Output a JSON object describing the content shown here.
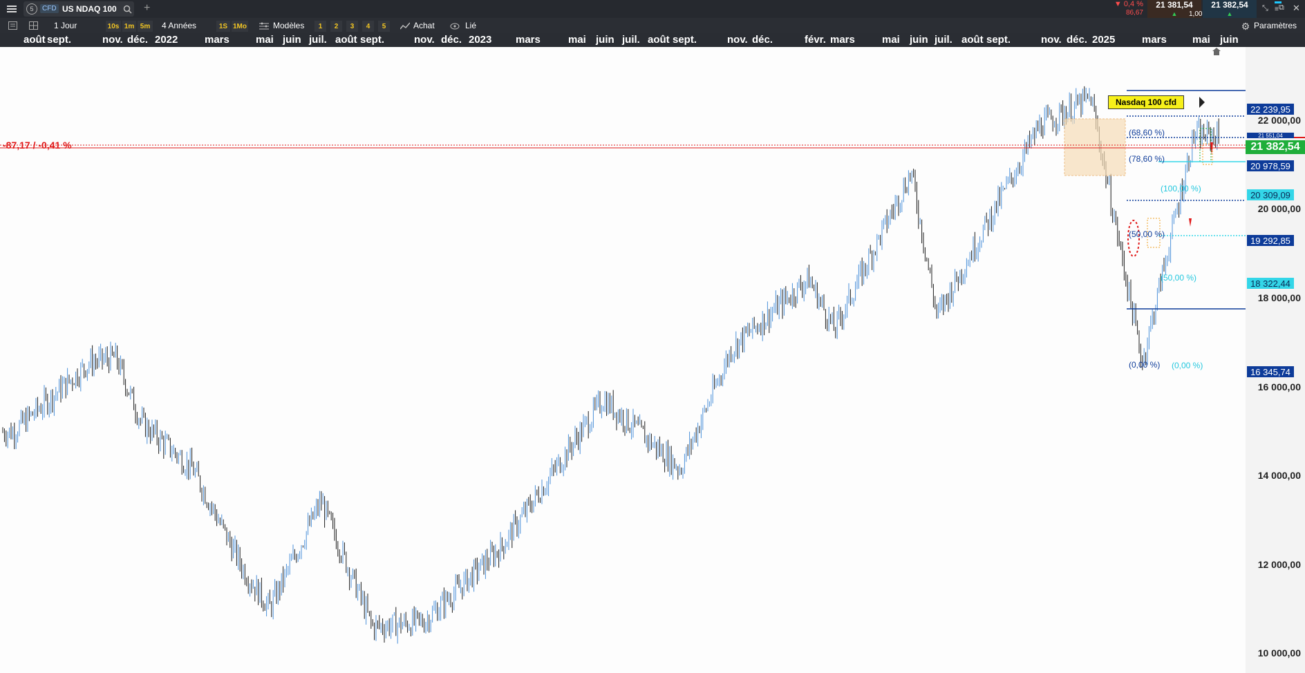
{
  "instrument": {
    "badge": "CFD",
    "name": "US NDAQ 100",
    "label": "Nasdaq 100  cfd"
  },
  "topbar": {
    "change_pct": "▼ 0,4 %",
    "change_pts": "86,67",
    "bid": "21 381,54",
    "ask": "21 382,54",
    "spread": "1,00",
    "plus": "+"
  },
  "toolbar": {
    "period": "1 Jour",
    "intervals": [
      "10s",
      "1m",
      "5m"
    ],
    "range": "4 Années",
    "periods": [
      "1S",
      "1Mo"
    ],
    "models": "Modèles",
    "layouts": [
      "1",
      "2",
      "3",
      "4",
      "5"
    ],
    "buy": "Achat",
    "linked": "Lié",
    "settings": "Paramètres"
  },
  "months": [
    "août",
    "sept.",
    "nov.",
    "déc.",
    "2022",
    "mars",
    "mai",
    "juin",
    "juil.",
    "août",
    "sept.",
    "nov.",
    "déc.",
    "2023",
    "mars",
    "mai",
    "juin",
    "juil.",
    "août",
    "sept.",
    "nov.",
    "déc.",
    "févr.",
    "mars",
    "mai",
    "juin",
    "juil.",
    "août",
    "sept.",
    "nov.",
    "déc.",
    "2025",
    "mars",
    "mai",
    "juin"
  ],
  "yaxis": [
    "22 000,00",
    "20 000,00",
    "18 000,00",
    "16 000,00",
    "14 000,00",
    "12 000,00",
    "10 000,00"
  ],
  "price_tags": {
    "high": "22 239,95",
    "current": "21 382,54",
    "fib786": "20 978,59",
    "fib100": "20 309,09",
    "fib50": "19 292,85",
    "ext50": "18 322,44",
    "low": "16 345,74",
    "hidden": "21 551,04"
  },
  "fib_labels": {
    "l618": "(68,60 %)",
    "l786": "(78,60 %)",
    "l100": "(100,00 %)",
    "l50": "(50,00 %)",
    "l50b": "(50,00 %)",
    "l0": "(0,00 %)",
    "l0b": "(0,00 %)"
  },
  "change_overlay": "-87,17 / -0,41 %",
  "colors": {
    "up": "#4a90d9",
    "down": "#1a1a1a",
    "accent": "#f3c623",
    "green": "#1fae3a",
    "navy": "#0d3b99",
    "cyan": "#33d6e8",
    "red": "#e01818"
  },
  "chart_data": {
    "type": "candlestick",
    "title": "Nasdaq 100  cfd",
    "timeframe": "1 Jour",
    "range": "4 Années",
    "ylim": [
      9800,
      23300
    ],
    "approx_daily_close_path": [
      {
        "date": "2021-08",
        "value": 15000
      },
      {
        "date": "2021-11",
        "value": 16500
      },
      {
        "date": "2021-12",
        "value": 16600
      },
      {
        "date": "2022-01",
        "value": 15200
      },
      {
        "date": "2022-03",
        "value": 14200
      },
      {
        "date": "2022-05",
        "value": 12000
      },
      {
        "date": "2022-06",
        "value": 11200
      },
      {
        "date": "2022-08",
        "value": 13500
      },
      {
        "date": "2022-10",
        "value": 10800
      },
      {
        "date": "2022-12",
        "value": 10900
      },
      {
        "date": "2023-03",
        "value": 12500
      },
      {
        "date": "2023-06",
        "value": 14900
      },
      {
        "date": "2023-07",
        "value": 15700
      },
      {
        "date": "2023-10",
        "value": 14200
      },
      {
        "date": "2023-12",
        "value": 16800
      },
      {
        "date": "2024-03",
        "value": 18300
      },
      {
        "date": "2024-04",
        "value": 17200
      },
      {
        "date": "2024-07",
        "value": 20600
      },
      {
        "date": "2024-08",
        "value": 17500
      },
      {
        "date": "2024-12",
        "value": 21600
      },
      {
        "date": "2025-02",
        "value": 22200
      },
      {
        "date": "2025-04",
        "value": 16500
      },
      {
        "date": "2025-06",
        "value": 21382
      }
    ],
    "horizontal_levels": [
      22239.95,
      21551.04,
      21382.54,
      20978.59,
      20309.09,
      19292.85,
      18322.44,
      16345.74
    ]
  }
}
